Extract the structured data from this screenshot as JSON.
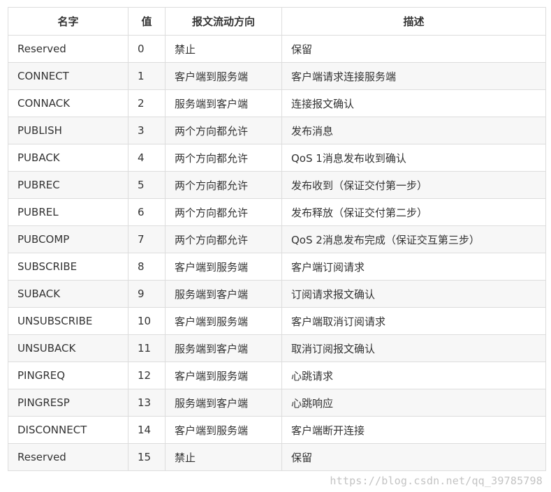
{
  "table": {
    "headers": [
      "名字",
      "值",
      "报文流动方向",
      "描述"
    ],
    "rows": [
      [
        "Reserved",
        "0",
        "禁止",
        "保留"
      ],
      [
        "CONNECT",
        "1",
        "客户端到服务端",
        "客户端请求连接服务端"
      ],
      [
        "CONNACK",
        "2",
        "服务端到客户端",
        "连接报文确认"
      ],
      [
        "PUBLISH",
        "3",
        "两个方向都允许",
        "发布消息"
      ],
      [
        "PUBACK",
        "4",
        "两个方向都允许",
        "QoS 1消息发布收到确认"
      ],
      [
        "PUBREC",
        "5",
        "两个方向都允许",
        "发布收到（保证交付第一步）"
      ],
      [
        "PUBREL",
        "6",
        "两个方向都允许",
        "发布释放（保证交付第二步）"
      ],
      [
        "PUBCOMP",
        "7",
        "两个方向都允许",
        "QoS 2消息发布完成（保证交互第三步）"
      ],
      [
        "SUBSCRIBE",
        "8",
        "客户端到服务端",
        "客户端订阅请求"
      ],
      [
        "SUBACK",
        "9",
        "服务端到客户端",
        "订阅请求报文确认"
      ],
      [
        "UNSUBSCRIBE",
        "10",
        "客户端到服务端",
        "客户端取消订阅请求"
      ],
      [
        "UNSUBACK",
        "11",
        "服务端到客户端",
        "取消订阅报文确认"
      ],
      [
        "PINGREQ",
        "12",
        "客户端到服务端",
        "心跳请求"
      ],
      [
        "PINGRESP",
        "13",
        "服务端到客户端",
        "心跳响应"
      ],
      [
        "DISCONNECT",
        "14",
        "客户端到服务端",
        "客户端断开连接"
      ],
      [
        "Reserved",
        "15",
        "禁止",
        "保留"
      ]
    ]
  },
  "watermark": "https://blog.csdn.net/qq_39785798",
  "colors": {
    "border": "#dddddd",
    "stripe": "#f7f7f7",
    "text": "#333333"
  }
}
